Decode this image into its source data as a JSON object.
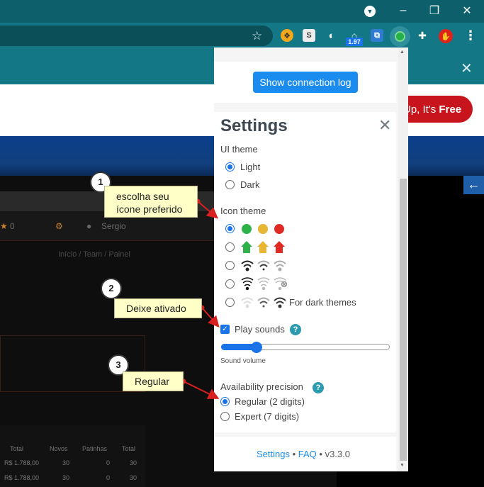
{
  "browser": {
    "window_controls": {
      "minimize": "–",
      "restore": "❐",
      "close": "✕"
    },
    "extensions": [
      {
        "name": "extension-bulb",
        "glyph": "❖",
        "bg": "#f2a71b"
      },
      {
        "name": "extension-s",
        "glyph": "S",
        "bg": "#ededed"
      },
      {
        "name": "extension-moon",
        "glyph": "◐",
        "bg": "#137785"
      },
      {
        "name": "extension-nodes",
        "glyph": "⌂",
        "bg": "#137785"
      },
      {
        "name": "extension-code",
        "glyph": "⧉",
        "bg": "#2e7dd1"
      },
      {
        "name": "extension-availability",
        "glyph": "",
        "bg": "#24b14a"
      },
      {
        "name": "extensions-puzzle",
        "glyph": "✚",
        "bg": "#137785"
      },
      {
        "name": "extension-hand",
        "glyph": "✋",
        "bg": "#e0221a"
      }
    ],
    "badge": "1.97"
  },
  "page_behind": {
    "signup_prefix": "Up, It's ",
    "signup_bold": "Free",
    "counter": "0",
    "user_name": "Sergio",
    "breadcrumb": "Início  /  Team  /  Painel",
    "table_headers": [
      "Total",
      "Novos",
      "Patinhas",
      "Total"
    ],
    "table_rows": [
      [
        "R$ 1.788,00",
        "30",
        "0",
        "30"
      ],
      [
        "R$ 1.788,00",
        "30",
        "0",
        "30"
      ]
    ]
  },
  "popup": {
    "connection_log_button": "Show connection log",
    "settings_title": "Settings",
    "ui_theme": {
      "label": "UI theme",
      "options": [
        "Light",
        "Dark"
      ],
      "selected": "Light"
    },
    "icon_theme": {
      "label": "Icon theme",
      "dark_themes_label": "For dark themes",
      "colors": {
        "green": "#2db24a",
        "yellow": "#e8b635",
        "red": "#e02b24"
      }
    },
    "play_sounds": {
      "label": "Play sounds",
      "checked": true,
      "help": "?"
    },
    "sound_volume": {
      "label": "Sound volume",
      "value": 0.21
    },
    "availability_precision": {
      "label": "Availability precision",
      "help": "?",
      "options": [
        "Regular (2 digits)",
        "Expert (7 digits)"
      ],
      "selected": "Regular (2 digits)"
    },
    "footer": {
      "settings": "Settings",
      "sep1": " • ",
      "faq": "FAQ",
      "sep2": " • ",
      "version": "v3.3.0"
    }
  },
  "annotations": [
    {
      "number": "1",
      "text_line1": "escolha seu",
      "text_line2": "ícone preferido"
    },
    {
      "number": "2",
      "text": "Deixe ativado"
    },
    {
      "number": "3",
      "text": "Regular"
    }
  ]
}
